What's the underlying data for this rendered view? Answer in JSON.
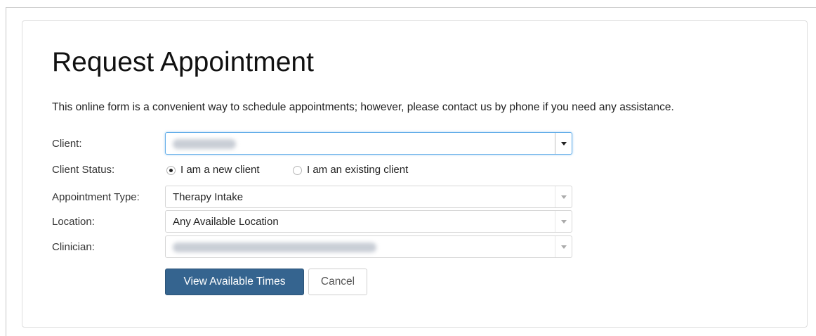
{
  "form": {
    "title": "Request Appointment",
    "intro": "This online form is a convenient way to schedule appointments; however, please contact us by phone if you need any assistance.",
    "client": {
      "label": "Client:",
      "value": ""
    },
    "client_status": {
      "label": "Client Status:",
      "options": [
        {
          "label": "I am a new client",
          "checked": true
        },
        {
          "label": "I am an existing client",
          "checked": false
        }
      ]
    },
    "appointment_type": {
      "label": "Appointment Type:",
      "value": "Therapy Intake"
    },
    "location": {
      "label": "Location:",
      "value": "Any Available Location"
    },
    "clinician": {
      "label": "Clinician:",
      "value": ""
    },
    "buttons": {
      "view_times": "View Available Times",
      "cancel": "Cancel"
    }
  },
  "colors": {
    "primary_button": "#35648f",
    "focus_border": "#66afe9"
  },
  "icons": {
    "dropdown": "chevron-down-icon",
    "radio": "radio-icon"
  }
}
